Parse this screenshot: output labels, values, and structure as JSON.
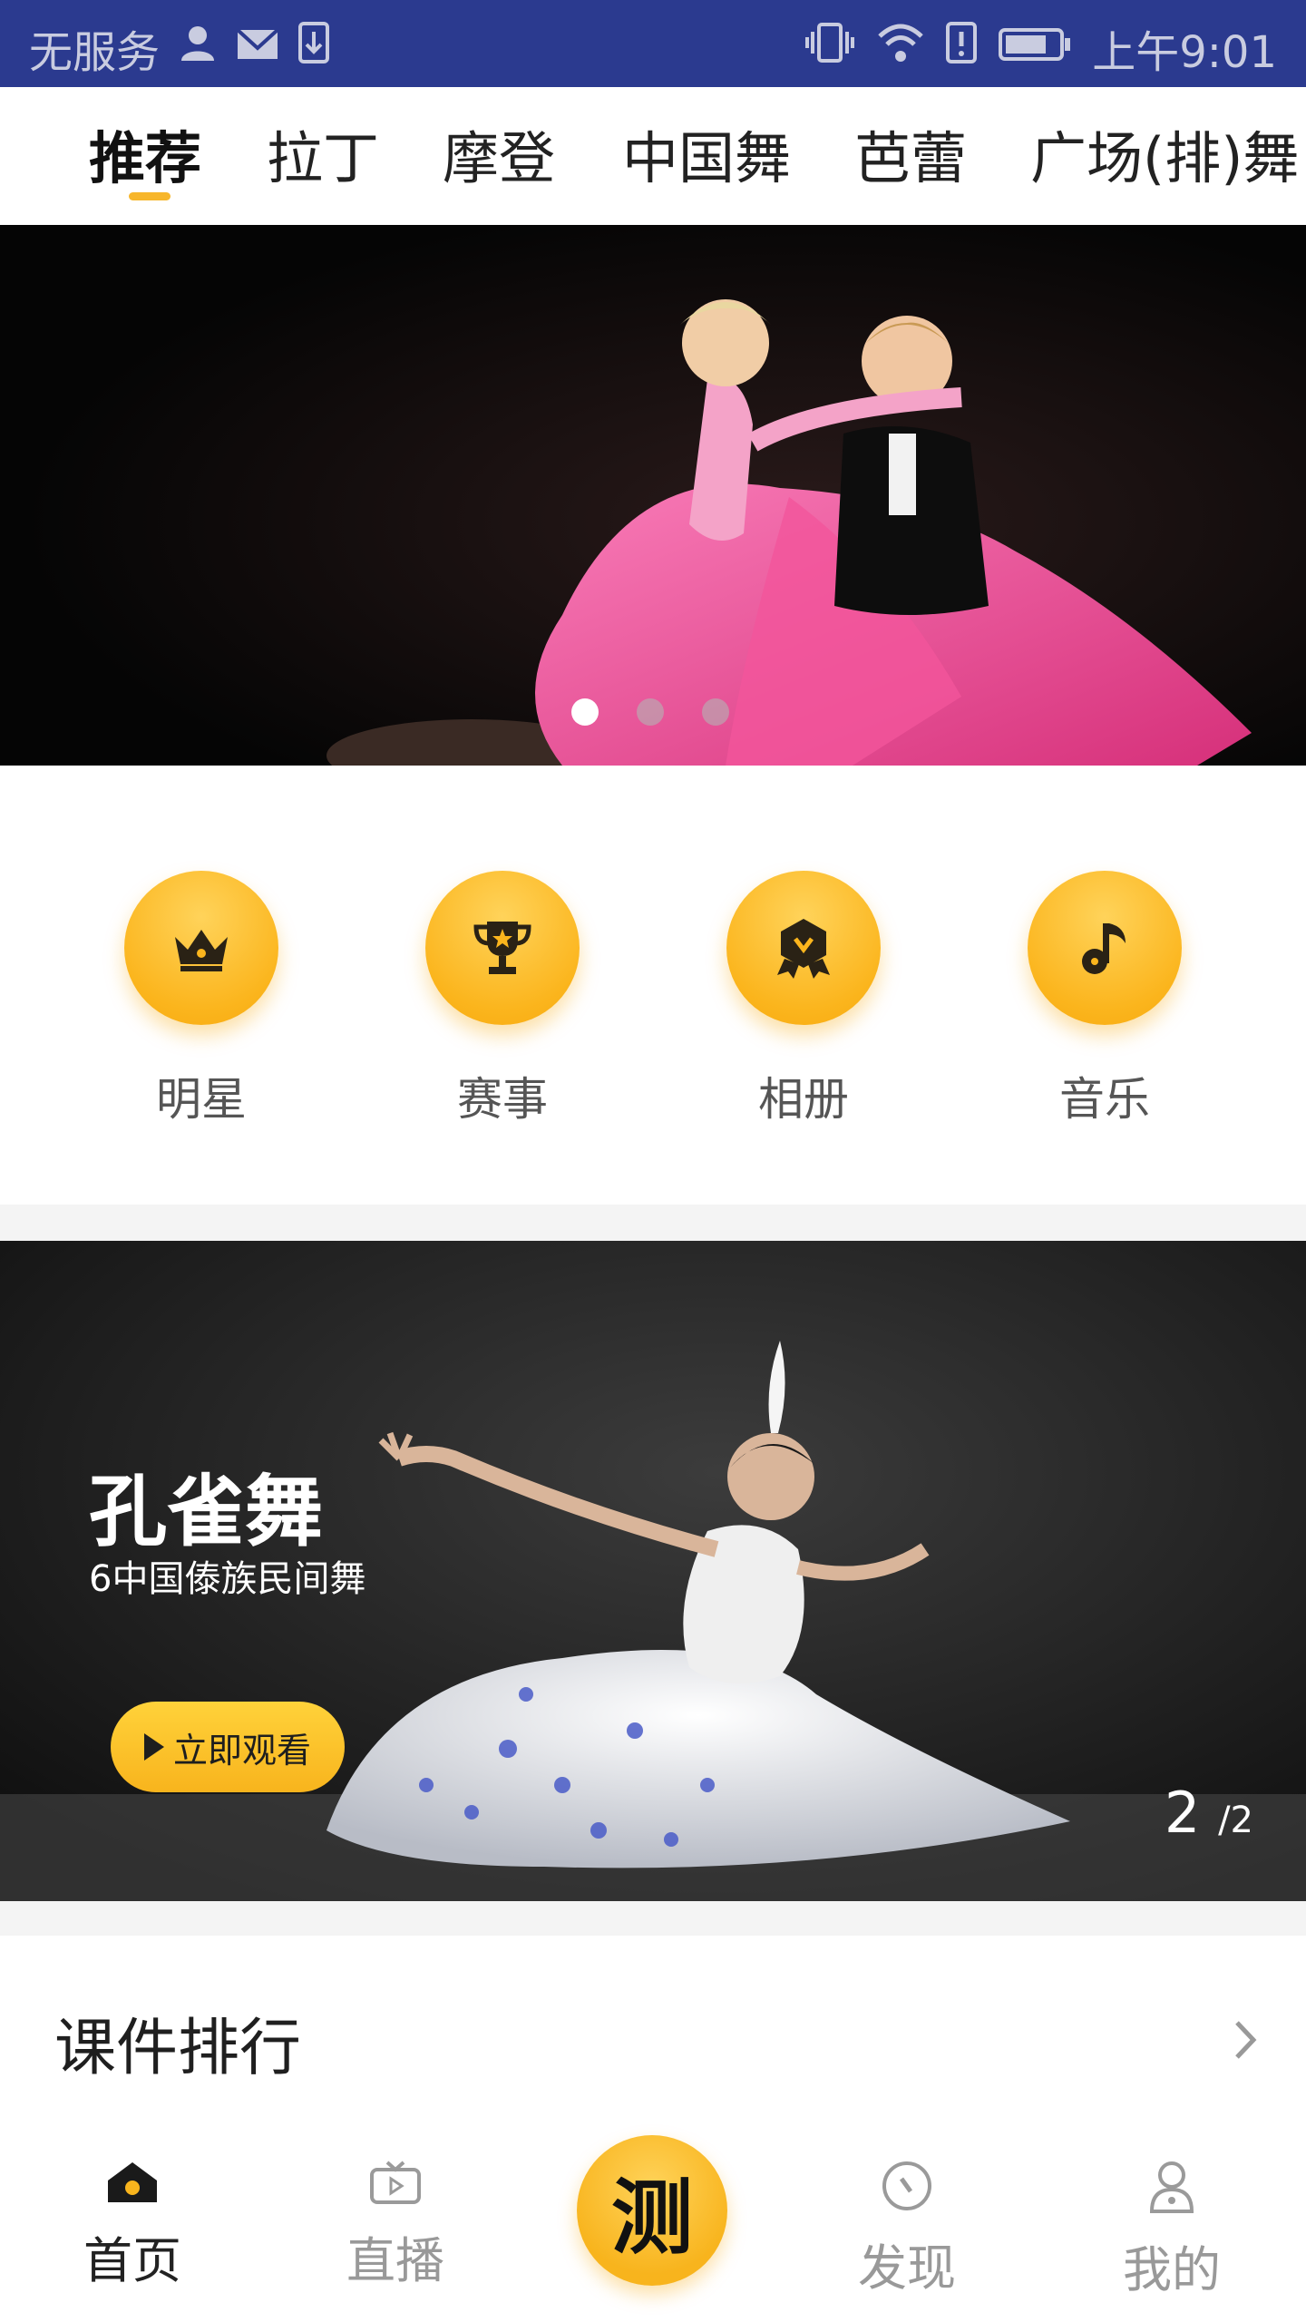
{
  "status_bar": {
    "carrier": "无服务",
    "time": "上午9:01",
    "icons": [
      "user-icon",
      "mail-icon",
      "download-icon",
      "vibrate-icon",
      "wifi-icon",
      "alert-icon",
      "battery-icon"
    ]
  },
  "top_tabs": {
    "active_index": 0,
    "items": [
      {
        "label": "推荐"
      },
      {
        "label": "拉丁"
      },
      {
        "label": "摩登"
      },
      {
        "label": "中国舞"
      },
      {
        "label": "芭蕾"
      },
      {
        "label": "广场(排)舞"
      }
    ],
    "accent": "#f7b62b"
  },
  "banner": {
    "slide_count": 3,
    "active_slide": 0
  },
  "quick_links": [
    {
      "label": "明星",
      "icon": "crown-icon"
    },
    {
      "label": "赛事",
      "icon": "trophy-icon"
    },
    {
      "label": "相册",
      "icon": "medal-icon"
    },
    {
      "label": "音乐",
      "icon": "music-note-icon"
    }
  ],
  "feature": {
    "title": "孔雀舞",
    "subtitle": "6中国傣族民间舞",
    "button_label": "立即观看",
    "page_current": "2",
    "page_total": "/2"
  },
  "ranking": {
    "title": "课件排行"
  },
  "bottom_nav": {
    "active_index": 0,
    "items": [
      {
        "label": "首页",
        "icon": "home-icon"
      },
      {
        "label": "直播",
        "icon": "tv-icon"
      },
      {
        "label": "测",
        "icon": "center-action-icon"
      },
      {
        "label": "发现",
        "icon": "compass-icon"
      },
      {
        "label": "我的",
        "icon": "profile-icon"
      }
    ]
  },
  "colors": {
    "status_bar": "#2b3a8f",
    "accent": "#f7b62b",
    "page_bg": "#f4f4f4"
  }
}
